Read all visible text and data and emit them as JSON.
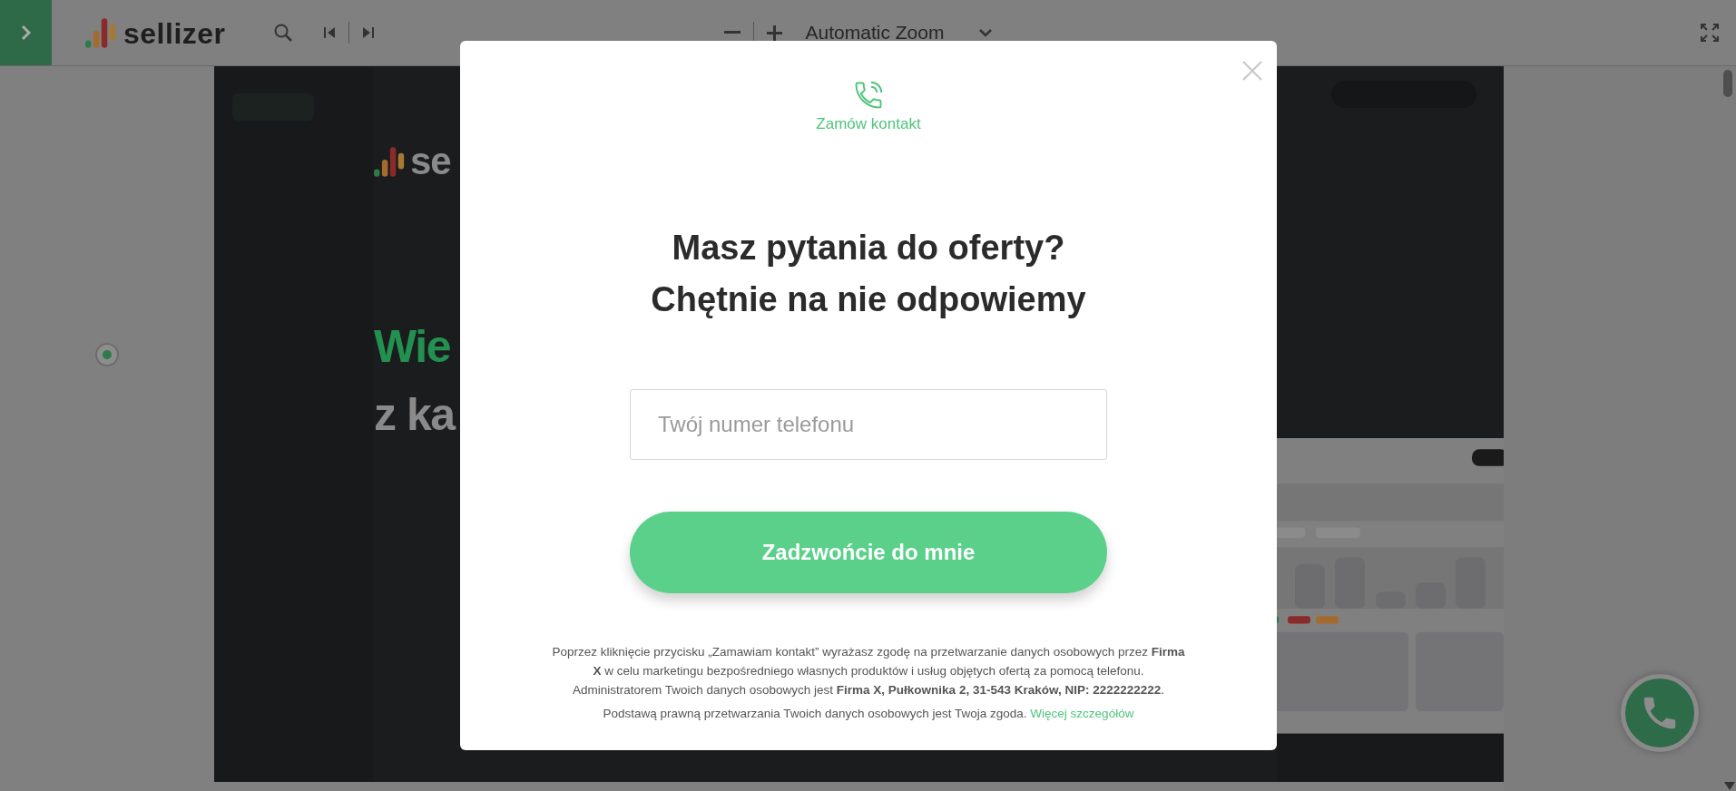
{
  "toolbar": {
    "logo_text": "sellizer",
    "zoom_label": "Automatic Zoom"
  },
  "document": {
    "logo_text": "se",
    "headline_line_1": "Wie",
    "headline_line_2": "z ka"
  },
  "modal": {
    "label": "Zamów kontakt",
    "title_lines": [
      "Masz pytania do oferty?",
      "Chętnie na nie odpowiemy"
    ],
    "phone_field": {
      "placeholder": "Twój numer telefonu"
    },
    "submit_button": "Zadzwońcie do mnie",
    "consent": "Poprzez kliknięcie przycisku „Zamawiam kontakt” wyrażasz zgodę na przetwarzanie danych osobowych przez **Firma X** w celu marketingu bezpośredniego własnych produktów i usług objętych ofertą za pomocą telefonu. Administratorem Twoich danych osobowych jest **Firma X, Pułkownika 2, 31-543 Kraków, NIP: 2222222222**.",
    "legal_basis": "Podstawą prawną przetwarzania Twoich danych osobowych jest Twoja zgoda.",
    "more_link": "Więcej szczegółów"
  }
}
